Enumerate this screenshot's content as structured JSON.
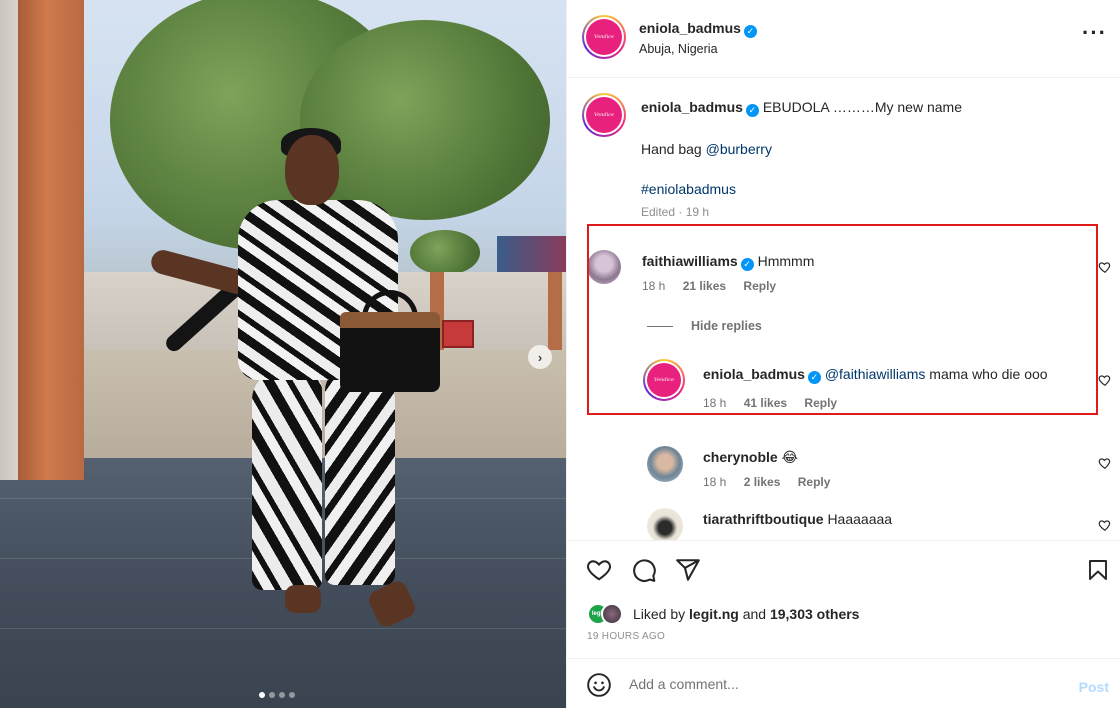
{
  "post": {
    "username": "eniola_badmus",
    "location": "Abuja, Nigeria",
    "avatar_text": "Vendice"
  },
  "caption": {
    "username": "eniola_badmus",
    "text": "EBUDOLA ………My new name",
    "line2_prefix": "Hand bag ",
    "line2_mention": "@burberry",
    "hashtag": "#eniolabadmus",
    "edited": "Edited · 19 h"
  },
  "comments": [
    {
      "username": "faithiawilliams",
      "text": "Hmmmm",
      "time": "18 h",
      "likes": "21 likes",
      "reply": "Reply"
    }
  ],
  "hide_replies": "Hide replies",
  "replies": [
    {
      "username": "eniola_badmus",
      "mention": "@faithiawilliams",
      "text": " mama who die ooo",
      "time": "18 h",
      "likes": "41 likes",
      "reply": "Reply"
    },
    {
      "username": "cherynoble",
      "text": "😂",
      "time": "18 h",
      "likes": "2 likes",
      "reply": "Reply"
    },
    {
      "username": "tiarathriftboutique",
      "text": "Haaaaaaa"
    }
  ],
  "likes": {
    "prefix": "Liked by ",
    "user": "legit.ng",
    "middle": " and ",
    "count": "19,303 others",
    "avatar1_text": "legit"
  },
  "time_ago": "19 HOURS AGO",
  "add_comment": {
    "placeholder": "Add a comment...",
    "post_label": "Post"
  },
  "colors": {
    "verified": "#0095f6",
    "highlight": "#e01a1a",
    "link": "#00376b",
    "post_button": "#b3dbff"
  },
  "carousel": {
    "slides": 4,
    "current": 1
  }
}
